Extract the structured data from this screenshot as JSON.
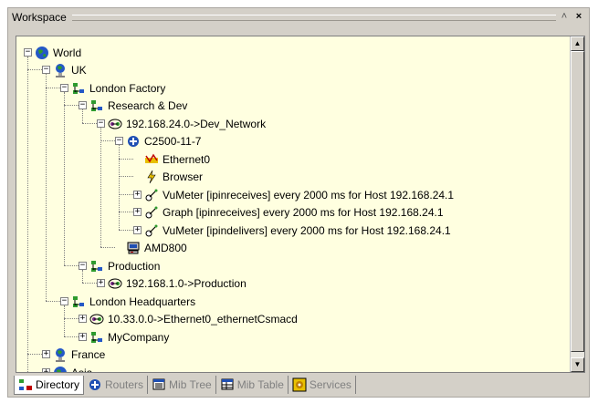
{
  "window": {
    "title": "Workspace"
  },
  "title_buttons": {
    "pin": "˄",
    "close": "×"
  },
  "tree": [
    {
      "label": "World",
      "expander": "−",
      "icon": "globe-icon"
    },
    {
      "label": "UK",
      "expander": "−",
      "icon": "flag-icon"
    },
    {
      "label": "London Factory",
      "expander": "−",
      "icon": "network-icon"
    },
    {
      "label": "Research & Dev",
      "expander": "−",
      "icon": "network-icon"
    },
    {
      "label": "192.168.24.0->Dev_Network",
      "expander": "−",
      "icon": "subnet-icon"
    },
    {
      "label": "C2500-11-7",
      "expander": "−",
      "icon": "router-icon"
    },
    {
      "label": "Ethernet0",
      "expander": "",
      "icon": "interface-icon"
    },
    {
      "label": "Browser",
      "expander": "",
      "icon": "browser-icon"
    },
    {
      "label": "VuMeter [ipinreceives] every 2000 ms for Host 192.168.24.1",
      "expander": "+",
      "icon": "meter-icon"
    },
    {
      "label": "Graph [ipinreceives] every 2000 ms for Host 192.168.24.1",
      "expander": "+",
      "icon": "meter-icon"
    },
    {
      "label": "VuMeter [ipindelivers] every 2000 ms for Host 192.168.24.1",
      "expander": "+",
      "icon": "meter-icon"
    },
    {
      "label": "AMD800",
      "expander": "",
      "icon": "computer-icon"
    },
    {
      "label": "Production",
      "expander": "−",
      "icon": "network-icon"
    },
    {
      "label": "192.168.1.0->Production",
      "expander": "+",
      "icon": "subnet-icon"
    },
    {
      "label": "London Headquarters",
      "expander": "−",
      "icon": "network-icon"
    },
    {
      "label": "10.33.0.0->Ethernet0_ethernetCsmacd",
      "expander": "+",
      "icon": "subnet-icon"
    },
    {
      "label": "MyCompany",
      "expander": "+",
      "icon": "network-icon"
    },
    {
      "label": "France",
      "expander": "+",
      "icon": "flag-icon"
    },
    {
      "label": "Asia",
      "expander": "+",
      "icon": "globe-icon"
    }
  ],
  "tabs": [
    {
      "label": "Directory",
      "icon": "directory-icon",
      "active": true
    },
    {
      "label": "Routers",
      "icon": "routers-icon",
      "active": false
    },
    {
      "label": "Mib Tree",
      "icon": "mib-tree-icon",
      "active": false
    },
    {
      "label": "Mib Table",
      "icon": "mib-table-icon",
      "active": false
    },
    {
      "label": "Services",
      "icon": "services-icon",
      "active": false
    }
  ],
  "colors": {
    "tree_bg": "#ffffe0",
    "panel_bg": "#d4d0c8",
    "accent_green": "#2e9b2e",
    "accent_blue": "#1f4fb3"
  }
}
